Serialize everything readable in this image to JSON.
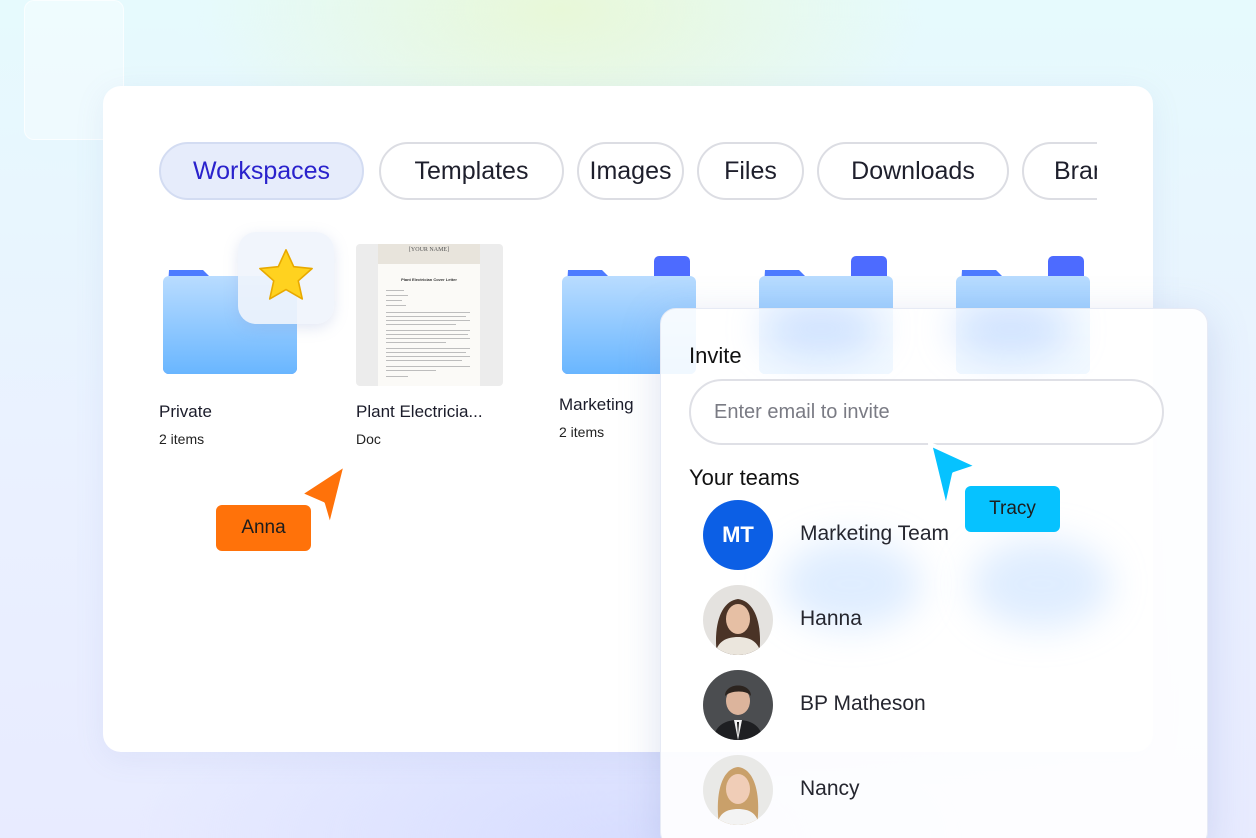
{
  "tabs": [
    {
      "label": "Workspaces",
      "active": true
    },
    {
      "label": "Templates",
      "active": false
    },
    {
      "label": "Images",
      "active": false
    },
    {
      "label": "Files",
      "active": false
    },
    {
      "label": "Downloads",
      "active": false
    },
    {
      "label": "Brand",
      "active": false
    }
  ],
  "items": [
    {
      "name": "Private",
      "sub": "2 items",
      "type": "folder",
      "starred": true
    },
    {
      "name": "Plant Electricia...",
      "sub": "Doc",
      "type": "document",
      "thumb_header": "[YOUR NAME]",
      "thumb_title": "Plant Electrician Cover Letter"
    },
    {
      "name": "Marketing",
      "sub": "2 items",
      "type": "folder"
    },
    {
      "name": "",
      "sub": "",
      "type": "folder"
    },
    {
      "name": "",
      "sub": "",
      "type": "folder"
    }
  ],
  "collaborators": {
    "anna": {
      "label": "Anna",
      "color": "#ff720a"
    },
    "tracy": {
      "label": "Tracy",
      "color": "#06c2ff"
    }
  },
  "invite": {
    "title": "Invite",
    "placeholder": "Enter email to invite",
    "teams_label": "Your teams",
    "teams": [
      {
        "name": "Marketing Team",
        "initials": "MT",
        "avatar": "initials"
      },
      {
        "name": "Hanna",
        "avatar": "photo-woman-curly"
      },
      {
        "name": "BP Matheson",
        "avatar": "photo-man-suit"
      },
      {
        "name": "Nancy",
        "avatar": "photo-woman-blonde"
      }
    ]
  }
}
